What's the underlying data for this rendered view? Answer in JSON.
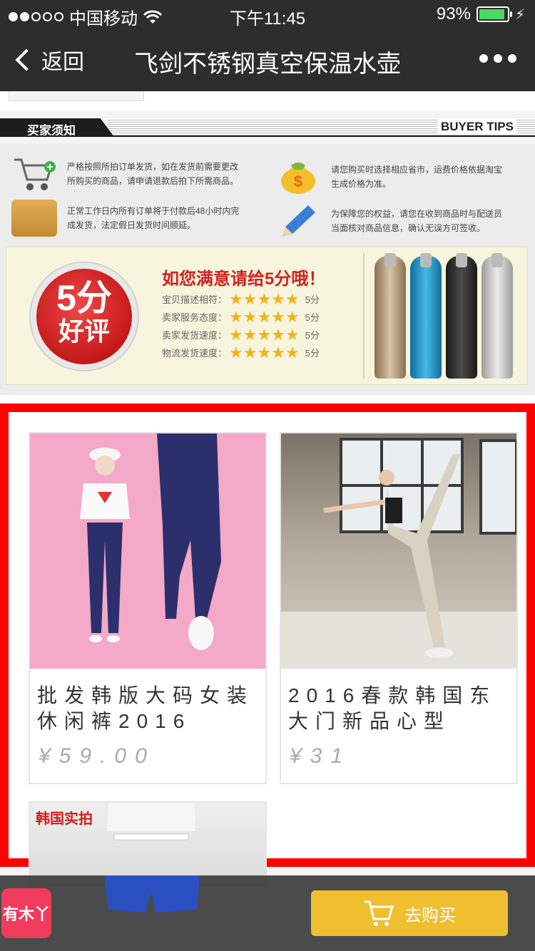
{
  "status_bar": {
    "carrier": "中国移动",
    "time": "下午11:45",
    "battery_percent": "93%",
    "battery_level": 0.93
  },
  "nav": {
    "back_label": "返回",
    "title": "飞剑不锈钢真空保温水壶"
  },
  "buyer_tips": {
    "header_cn": "买家须知",
    "header_en": "BUYER TIPS",
    "tips": [
      {
        "icon": "cart-icon",
        "text": "严格按照所拍订单发货，如在发货前需要更改所购买的商品，请申请退款后拍下所需商品。"
      },
      {
        "icon": "money-bag-icon",
        "text": "请您购买时选择相应省市，运费价格依据淘宝生成价格为准。"
      },
      {
        "icon": "box-icon",
        "text": "正常工作日内所有订单将于付款后48小时内完成发货，法定假日发货时间顺延。"
      },
      {
        "icon": "pencil-icon",
        "text": "为保障您的权益，请您在收到商品时与配送员当面核对商品信息，确认无误方可签收。"
      }
    ]
  },
  "rating": {
    "badge_line1": "5分",
    "badge_line2": "好评",
    "title": "如您满意请给5分哦！",
    "rows": [
      {
        "label": "宝贝描述相符：",
        "score": "5分",
        "stars": 5
      },
      {
        "label": "卖家服务态度：",
        "score": "5分",
        "stars": 5
      },
      {
        "label": "卖家发货速度：",
        "score": "5分",
        "stars": 5
      },
      {
        "label": "物流发货速度：",
        "score": "5分",
        "stars": 5
      }
    ]
  },
  "products": [
    {
      "name": "批发韩版大码女装休闲裤2016",
      "price": "¥59.00",
      "image": "pink-pants-photo"
    },
    {
      "name": "2016春款韩国东大门新品心型",
      "price": "¥31",
      "image": "dancer-studio-photo"
    },
    {
      "name": "",
      "price": "",
      "tag": "韩国实拍",
      "image": "blue-shorts-photo"
    }
  ],
  "bottom_bar": {
    "shop_logo_text": "有木丫",
    "buy_label": "去购买"
  },
  "colors": {
    "header_bg": "#2d2d2d",
    "frame_red": "#ff0000",
    "buy_yellow": "#f0bf2f",
    "price_gray": "#aaaaaa",
    "star_gold": "#f4b21a"
  }
}
